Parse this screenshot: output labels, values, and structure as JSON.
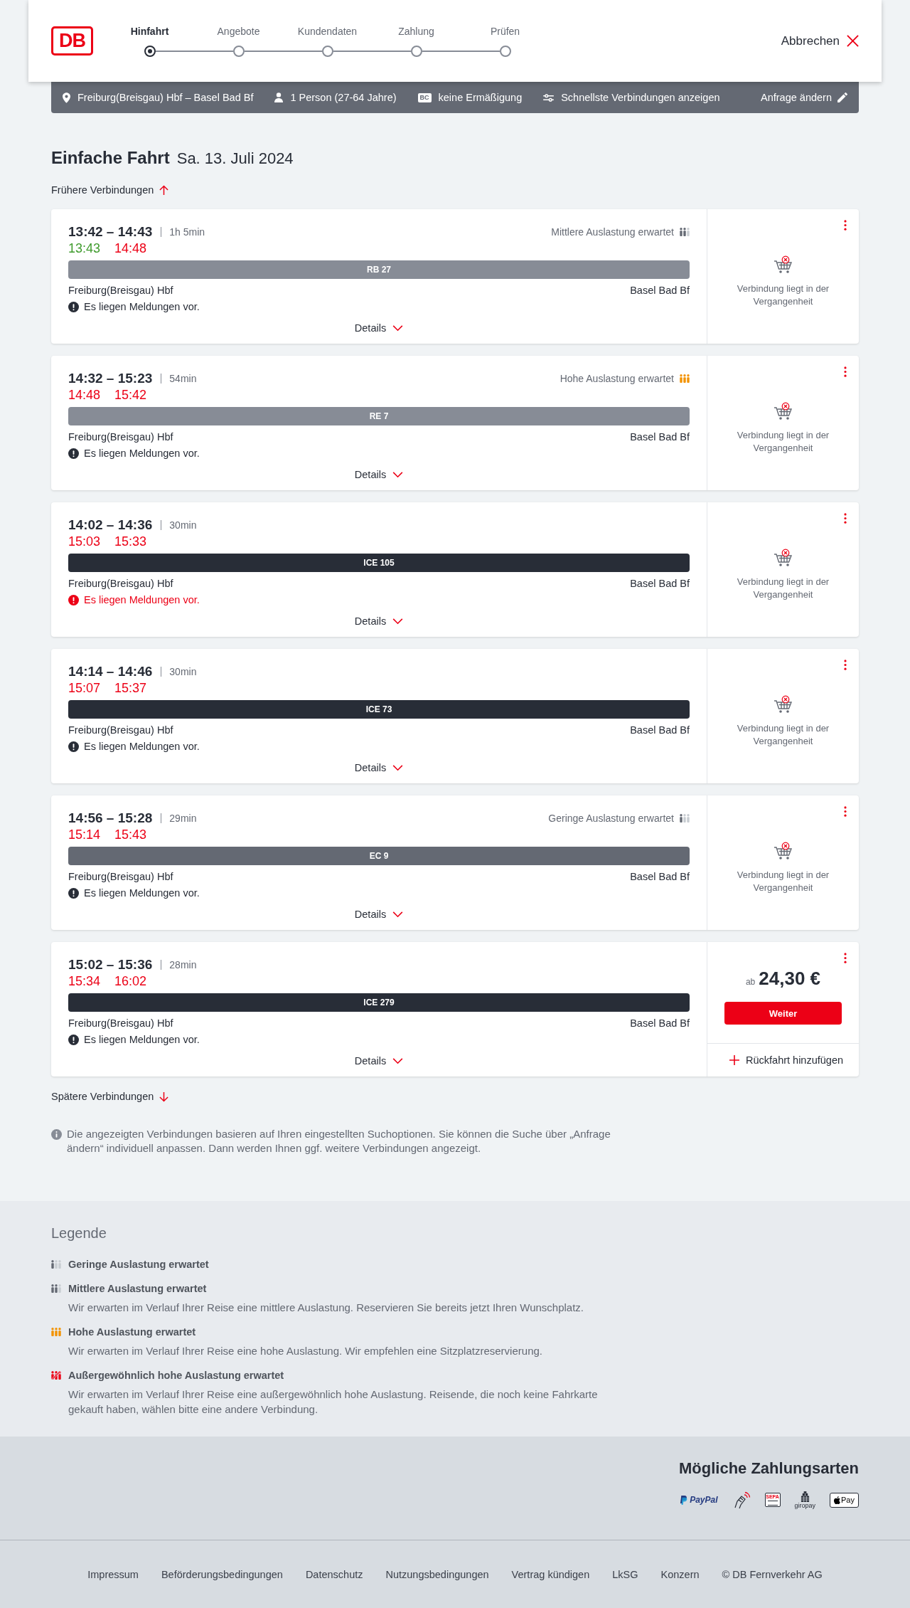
{
  "header": {
    "logo": "DB",
    "steps": [
      {
        "label": "Hinfahrt",
        "selected": true
      },
      {
        "label": "Angebote",
        "selected": false
      },
      {
        "label": "Kundendaten",
        "selected": false
      },
      {
        "label": "Zahlung",
        "selected": false
      },
      {
        "label": "Prüfen",
        "selected": false
      }
    ],
    "cancel": "Abbrechen"
  },
  "search_summary": {
    "items": [
      {
        "kind": "route",
        "text": "Freiburg(Breisgau) Hbf – Basel Bad Bf"
      },
      {
        "kind": "travellers",
        "text": "1 Person (27-64 Jahre)"
      },
      {
        "kind": "discount",
        "badge": "BC",
        "text": "keine Ermäßigung"
      },
      {
        "kind": "option",
        "text": "Schnellste Verbindungen anzeigen"
      }
    ],
    "edit": "Anfrage ändern"
  },
  "heading": {
    "title": "Einfache Fahrt",
    "date": "Sa. 13. Juli 2024"
  },
  "earlier": "Frühere Verbindungen",
  "connections": [
    {
      "times": "13:42 – 14:43",
      "duration": "1h 5min",
      "occupancy": {
        "kind": "medium",
        "label": "Mittlere Auslastung erwartet"
      },
      "realtime": [
        {
          "time": "13:43",
          "delayed": false
        },
        {
          "time": "14:48",
          "delayed": true
        }
      ],
      "train": {
        "kind": "regional",
        "label": "RB 27"
      },
      "from": "Freiburg(Breisgau) Hbf",
      "to": "Basel Bad Bf",
      "message": {
        "text": "Es liegen Meldungen vor.",
        "important": false
      },
      "details": "Details",
      "offer": {
        "kind": "past",
        "text": "Verbindung liegt in der Vergangenheit"
      }
    },
    {
      "times": "14:32 – 15:23",
      "duration": "54min",
      "occupancy": {
        "kind": "high",
        "label": "Hohe Auslastung erwartet"
      },
      "realtime": [
        {
          "time": "14:48",
          "delayed": true
        },
        {
          "time": "15:42",
          "delayed": true
        }
      ],
      "train": {
        "kind": "regional",
        "label": "RE 7"
      },
      "from": "Freiburg(Breisgau) Hbf",
      "to": "Basel Bad Bf",
      "message": {
        "text": "Es liegen Meldungen vor.",
        "important": false
      },
      "details": "Details",
      "offer": {
        "kind": "past",
        "text": "Verbindung liegt in der Vergangenheit"
      }
    },
    {
      "times": "14:02 – 14:36",
      "duration": "30min",
      "realtime": [
        {
          "time": "15:03",
          "delayed": true
        },
        {
          "time": "15:33",
          "delayed": true
        }
      ],
      "train": {
        "kind": "ice",
        "label": "ICE 105"
      },
      "from": "Freiburg(Breisgau) Hbf",
      "to": "Basel Bad Bf",
      "message": {
        "text": "Es liegen Meldungen vor.",
        "important": true
      },
      "details": "Details",
      "offer": {
        "kind": "past",
        "text": "Verbindung liegt in der Vergangenheit"
      }
    },
    {
      "times": "14:14 – 14:46",
      "duration": "30min",
      "realtime": [
        {
          "time": "15:07",
          "delayed": true
        },
        {
          "time": "15:37",
          "delayed": true
        }
      ],
      "train": {
        "kind": "ice",
        "label": "ICE 73"
      },
      "from": "Freiburg(Breisgau) Hbf",
      "to": "Basel Bad Bf",
      "message": {
        "text": "Es liegen Meldungen vor.",
        "important": false
      },
      "details": "Details",
      "offer": {
        "kind": "past",
        "text": "Verbindung liegt in der Vergangenheit"
      }
    },
    {
      "times": "14:56 – 15:28",
      "duration": "29min",
      "occupancy": {
        "kind": "low",
        "label": "Geringe Auslastung erwartet"
      },
      "realtime": [
        {
          "time": "15:14",
          "delayed": true
        },
        {
          "time": "15:43",
          "delayed": true
        }
      ],
      "train": {
        "kind": "ec",
        "label": "EC 9"
      },
      "from": "Freiburg(Breisgau) Hbf",
      "to": "Basel Bad Bf",
      "message": {
        "text": "Es liegen Meldungen vor.",
        "important": false
      },
      "details": "Details",
      "offer": {
        "kind": "past",
        "text": "Verbindung liegt in der Vergangenheit"
      }
    },
    {
      "times": "15:02 – 15:36",
      "duration": "28min",
      "realtime": [
        {
          "time": "15:34",
          "delayed": true
        },
        {
          "time": "16:02",
          "delayed": true
        }
      ],
      "train": {
        "kind": "ice",
        "label": "ICE 279"
      },
      "from": "Freiburg(Breisgau) Hbf",
      "to": "Basel Bad Bf",
      "message": {
        "text": "Es liegen Meldungen vor.",
        "important": false
      },
      "details": "Details",
      "offer": {
        "kind": "price",
        "prefix": "ab",
        "price": "24,30 €",
        "button": "Weiter",
        "add_return": "Rückfahrt hinzufügen"
      }
    }
  ],
  "later": "Spätere Verbindungen",
  "note": "Die angezeigten Verbindungen basieren auf Ihren eingestellten Suchoptionen. Sie können die Suche über „Anfrage ändern“ individuell anpassen. Dann werden Ihnen ggf. weitere Verbindungen angezeigt.",
  "legend": {
    "title": "Legende",
    "items": [
      {
        "kind": "low",
        "title": "Geringe Auslastung erwartet"
      },
      {
        "kind": "medium",
        "title": "Mittlere Auslastung erwartet",
        "description": "Wir erwarten im Verlauf Ihrer Reise eine mittlere Auslastung. Reservieren Sie bereits jetzt Ihren Wunschplatz."
      },
      {
        "kind": "high",
        "title": "Hohe Auslastung erwartet",
        "description": "Wir erwarten im Verlauf Ihrer Reise eine hohe Auslastung. Wir empfehlen eine Sitzplatzreservierung."
      },
      {
        "kind": "exceptional",
        "title": "Außergewöhnlich hohe Auslastung erwartet",
        "description": "Wir erwarten im Verlauf Ihrer Reise eine außergewöhnlich hohe Auslastung. Reisende, die noch keine Fahrkarte gekauft haben, wählen bitte eine andere Verbindung."
      }
    ]
  },
  "payment": {
    "title": "Mögliche Zahlungsarten",
    "methods": [
      {
        "kind": "paypal",
        "label": "PayPal"
      },
      {
        "kind": "contactless"
      },
      {
        "kind": "sepa",
        "label": "SEPA"
      },
      {
        "kind": "giropay",
        "label": "giropay"
      },
      {
        "kind": "applepay",
        "label": "Pay"
      }
    ]
  },
  "footer": {
    "links": [
      "Impressum",
      "Beförderungsbedingungen",
      "Datenschutz",
      "Nutzungsbedingungen",
      "Vertrag kündigen",
      "LkSG",
      "Konzern"
    ],
    "copyright": "© DB Fernverkehr AG"
  }
}
